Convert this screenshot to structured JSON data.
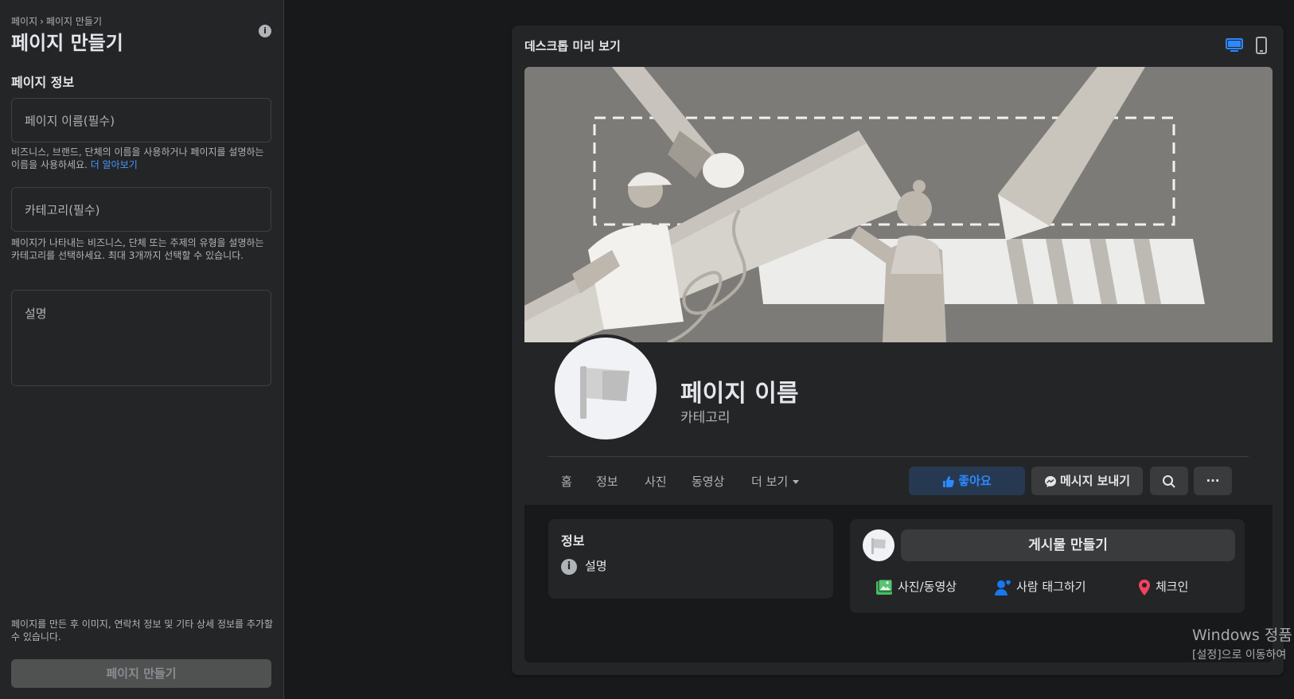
{
  "left_panel": {
    "breadcrumb": [
      "페이지",
      "페이지 만들기"
    ],
    "breadcrumb_sep": "›",
    "title": "페이지 만들기",
    "info_icon_glyph": "i",
    "section_title": "페이지 정보",
    "name_field": {
      "placeholder": "페이지 이름(필수)",
      "help": "비즈니스, 브랜드, 단체의 이름을 사용하거나 페이지를 설명하는 이름을 사용하세요.",
      "help_link": "더 알아보기"
    },
    "category_field": {
      "placeholder": "카테고리(필수)",
      "help": "페이지가 나타내는 비즈니스, 단체 또는 주제의 유형을 설명하는 카테고리를 선택하세요. 최대 3개까지 선택할 수 있습니다."
    },
    "description_field": {
      "placeholder": "설명"
    },
    "footnote": "페이지를 만든 후 이미지, 연락처 정보 및 기타 상세 정보를 추가할 수 있습니다.",
    "create_button": "페이지 만들기"
  },
  "preview": {
    "title": "데스크톱 미리 보기",
    "device_icons": [
      "desktop-icon",
      "mobile-icon"
    ],
    "page_name": "페이지 이름",
    "category": "카테고리",
    "tabs": [
      "홈",
      "정보",
      "사진",
      "동영상",
      "더 보기"
    ],
    "actions": {
      "like": "좋아요",
      "message": "메시지 보내기",
      "search_icon": "search-icon",
      "more_glyph": "···"
    },
    "info_card": {
      "title": "정보",
      "info_glyph": "i",
      "row": "설명"
    },
    "post_card": {
      "create_post": "게시물 만들기",
      "actions": [
        "사진/동영상",
        "사람 태그하기",
        "체크인"
      ]
    }
  },
  "colors": {
    "accent": "#2d88ff",
    "link": "#4599ff",
    "background": "#18191a",
    "surface": "#242526"
  },
  "watermark": {
    "line1": "Windows 정품",
    "line2": "[설정]으로 이동하여"
  }
}
